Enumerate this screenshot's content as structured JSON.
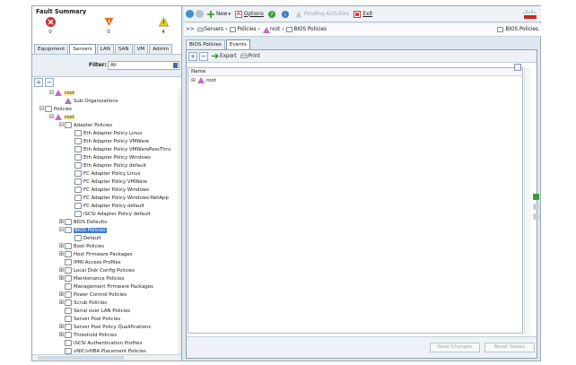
{
  "fault_summary": {
    "title": "Fault Summary",
    "critical": {
      "count": "0",
      "icon": "critical-x-icon",
      "color": "#c9342f"
    },
    "major": {
      "count": "0",
      "icon": "major-triangle-down-icon",
      "color": "#e2701e"
    },
    "minor": {
      "count": "4",
      "icon": "minor-triangle-icon",
      "color": "#f1d22a"
    }
  },
  "left_tabs": [
    "Equipment",
    "Servers",
    "LAN",
    "SAN",
    "VM",
    "Admin"
  ],
  "left_active_tab": "Servers",
  "filter": {
    "label": "Filter:",
    "value": "All"
  },
  "tree": [
    {
      "label": "root",
      "depth": 2,
      "icon": "org-icon",
      "exp": "-",
      "hl": true
    },
    {
      "label": "Sub-Organizations",
      "depth": 3,
      "icon": "org-icon",
      "exp": ""
    },
    {
      "label": "Policies",
      "depth": 1,
      "icon": "policy-icon",
      "exp": "-"
    },
    {
      "label": "root",
      "depth": 2,
      "icon": "org-icon",
      "exp": "-",
      "hl": true
    },
    {
      "label": "Adapter Policies",
      "depth": 3,
      "icon": "policy-icon",
      "exp": "-"
    },
    {
      "label": "Eth Adapter Policy Linux",
      "depth": 4,
      "icon": "policy-icon",
      "exp": ""
    },
    {
      "label": "Eth Adapter Policy VMWare",
      "depth": 4,
      "icon": "policy-icon",
      "exp": ""
    },
    {
      "label": "Eth Adapter Policy VMWarePassThru",
      "depth": 4,
      "icon": "policy-icon",
      "exp": ""
    },
    {
      "label": "Eth Adapter Policy Windows",
      "depth": 4,
      "icon": "policy-icon",
      "exp": ""
    },
    {
      "label": "Eth Adapter Policy default",
      "depth": 4,
      "icon": "policy-icon",
      "exp": ""
    },
    {
      "label": "FC Adapter Policy Linux",
      "depth": 4,
      "icon": "policy-icon",
      "exp": ""
    },
    {
      "label": "FC Adapter Policy VMWare",
      "depth": 4,
      "icon": "policy-icon",
      "exp": ""
    },
    {
      "label": "FC Adapter Policy Windows",
      "depth": 4,
      "icon": "policy-icon",
      "exp": ""
    },
    {
      "label": "FC Adapter Policy Windows-NetApp",
      "depth": 4,
      "icon": "policy-icon",
      "exp": ""
    },
    {
      "label": "FC Adapter Policy default",
      "depth": 4,
      "icon": "policy-icon",
      "exp": ""
    },
    {
      "label": "iSCSI Adapter Policy default",
      "depth": 4,
      "icon": "policy-icon",
      "exp": ""
    },
    {
      "label": "BIOS Defaults",
      "depth": 3,
      "icon": "policy-icon",
      "exp": "+"
    },
    {
      "label": "BIOS Policies",
      "depth": 3,
      "icon": "policy-icon",
      "exp": "-",
      "sel": true
    },
    {
      "label": "Default",
      "depth": 4,
      "icon": "policy-icon",
      "exp": ""
    },
    {
      "label": "Boot Policies",
      "depth": 3,
      "icon": "policy-icon",
      "exp": "+"
    },
    {
      "label": "Host Firmware Packages",
      "depth": 3,
      "icon": "policy-icon",
      "exp": "+"
    },
    {
      "label": "IPMI Access Profiles",
      "depth": 3,
      "icon": "policy-icon",
      "exp": ""
    },
    {
      "label": "Local Disk Config Policies",
      "depth": 3,
      "icon": "policy-icon",
      "exp": "+"
    },
    {
      "label": "Maintenance Policies",
      "depth": 3,
      "icon": "policy-icon",
      "exp": "+"
    },
    {
      "label": "Management Firmware Packages",
      "depth": 3,
      "icon": "policy-icon",
      "exp": ""
    },
    {
      "label": "Power Control Policies",
      "depth": 3,
      "icon": "policy-icon",
      "exp": "+"
    },
    {
      "label": "Scrub Policies",
      "depth": 3,
      "icon": "policy-icon",
      "exp": "+"
    },
    {
      "label": "Serial over LAN Policies",
      "depth": 3,
      "icon": "policy-icon",
      "exp": ""
    },
    {
      "label": "Server Pool Policies",
      "depth": 3,
      "icon": "policy-icon",
      "exp": ""
    },
    {
      "label": "Server Pool Policy Qualifications",
      "depth": 3,
      "icon": "policy-icon",
      "exp": "+"
    },
    {
      "label": "Threshold Policies",
      "depth": 3,
      "icon": "policy-icon",
      "exp": "+"
    },
    {
      "label": "iSCSI Authentication Profiles",
      "depth": 3,
      "icon": "policy-icon",
      "exp": ""
    },
    {
      "label": "vNIC/vHBA Placement Policies",
      "depth": 3,
      "icon": "policy-icon",
      "exp": ""
    }
  ],
  "toolbar": {
    "new_label": "New",
    "options_label": "Options",
    "pending_label": "Pending Activities",
    "exit_label": "Exit"
  },
  "breadcrumb": {
    "prefix": ">>",
    "items": [
      "Servers",
      "Policies",
      "root",
      "BIOS Policies"
    ],
    "current": "BIOS Policies"
  },
  "right_tabs": [
    "BIOS Policies",
    "Events"
  ],
  "right_active_tab": "Events",
  "content_toolbar": {
    "export_label": "Export",
    "print_label": "Print"
  },
  "grid": {
    "column": "Name",
    "rows": [
      "root"
    ]
  },
  "bottom_buttons": {
    "save_label": "Save Changes",
    "reset_label": "Reset Values"
  },
  "colors": {
    "accent": "#3e79c4",
    "panel_bg": "#dfe8f0"
  }
}
